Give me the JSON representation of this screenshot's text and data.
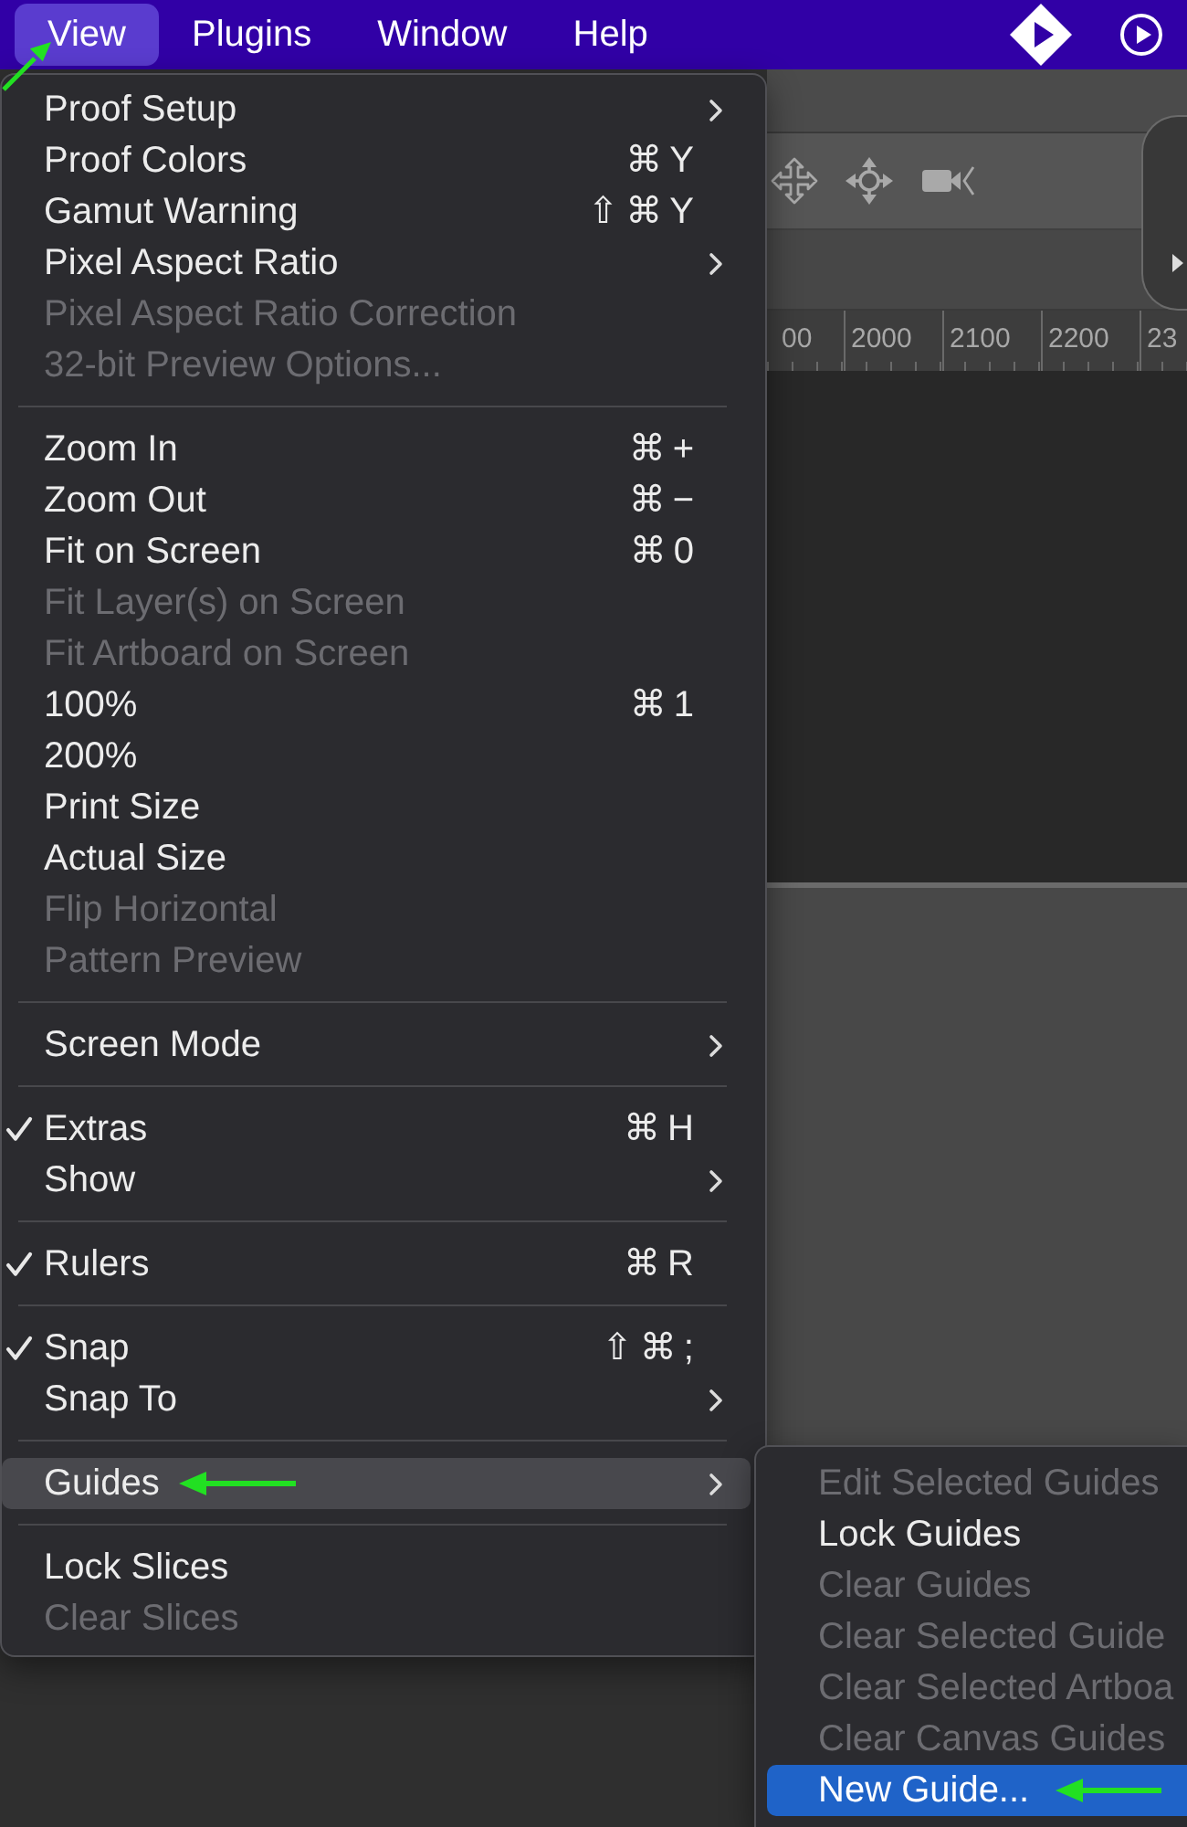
{
  "menu_bar": {
    "items": [
      {
        "label": "View",
        "selected": true,
        "annotation_arrow": true
      },
      {
        "label": "Plugins",
        "selected": false,
        "annotation_arrow": false
      },
      {
        "label": "Window",
        "selected": false,
        "annotation_arrow": false
      },
      {
        "label": "Help",
        "selected": false,
        "annotation_arrow": false
      }
    ]
  },
  "ruler": {
    "labels": [
      "00",
      "2000",
      "2100",
      "2200",
      "23"
    ]
  },
  "view_menu": {
    "items": [
      {
        "kind": "item",
        "label": "Proof Setup",
        "checked": false,
        "disabled": false,
        "has_submenu": true,
        "selected": false,
        "annotation_arrow": false
      },
      {
        "kind": "item",
        "label": "Proof Colors",
        "shortcut": "⌘Y",
        "checked": false,
        "disabled": false,
        "has_submenu": false,
        "selected": false,
        "annotation_arrow": false
      },
      {
        "kind": "item",
        "label": "Gamut Warning",
        "shortcut": "⇧⌘Y",
        "checked": false,
        "disabled": false,
        "has_submenu": false,
        "selected": false,
        "annotation_arrow": false
      },
      {
        "kind": "item",
        "label": "Pixel Aspect Ratio",
        "checked": false,
        "disabled": false,
        "has_submenu": true,
        "selected": false,
        "annotation_arrow": false
      },
      {
        "kind": "item",
        "label": "Pixel Aspect Ratio Correction",
        "checked": false,
        "disabled": true,
        "has_submenu": false,
        "selected": false,
        "annotation_arrow": false
      },
      {
        "kind": "item",
        "label": "32-bit Preview Options...",
        "checked": false,
        "disabled": true,
        "has_submenu": false,
        "selected": false,
        "annotation_arrow": false
      },
      {
        "kind": "separator"
      },
      {
        "kind": "item",
        "label": "Zoom In",
        "shortcut": "⌘+",
        "checked": false,
        "disabled": false,
        "has_submenu": false,
        "selected": false,
        "annotation_arrow": false
      },
      {
        "kind": "item",
        "label": "Zoom Out",
        "shortcut": "⌘−",
        "checked": false,
        "disabled": false,
        "has_submenu": false,
        "selected": false,
        "annotation_arrow": false
      },
      {
        "kind": "item",
        "label": "Fit on Screen",
        "shortcut": "⌘0",
        "checked": false,
        "disabled": false,
        "has_submenu": false,
        "selected": false,
        "annotation_arrow": false
      },
      {
        "kind": "item",
        "label": "Fit Layer(s) on Screen",
        "checked": false,
        "disabled": true,
        "has_submenu": false,
        "selected": false,
        "annotation_arrow": false
      },
      {
        "kind": "item",
        "label": "Fit Artboard on Screen",
        "checked": false,
        "disabled": true,
        "has_submenu": false,
        "selected": false,
        "annotation_arrow": false
      },
      {
        "kind": "item",
        "label": "100%",
        "shortcut": "⌘1",
        "checked": false,
        "disabled": false,
        "has_submenu": false,
        "selected": false,
        "annotation_arrow": false
      },
      {
        "kind": "item",
        "label": "200%",
        "checked": false,
        "disabled": false,
        "has_submenu": false,
        "selected": false,
        "annotation_arrow": false
      },
      {
        "kind": "item",
        "label": "Print Size",
        "checked": false,
        "disabled": false,
        "has_submenu": false,
        "selected": false,
        "annotation_arrow": false
      },
      {
        "kind": "item",
        "label": "Actual Size",
        "checked": false,
        "disabled": false,
        "has_submenu": false,
        "selected": false,
        "annotation_arrow": false
      },
      {
        "kind": "item",
        "label": "Flip Horizontal",
        "checked": false,
        "disabled": true,
        "has_submenu": false,
        "selected": false,
        "annotation_arrow": false
      },
      {
        "kind": "item",
        "label": "Pattern Preview",
        "checked": false,
        "disabled": true,
        "has_submenu": false,
        "selected": false,
        "annotation_arrow": false
      },
      {
        "kind": "separator"
      },
      {
        "kind": "item",
        "label": "Screen Mode",
        "checked": false,
        "disabled": false,
        "has_submenu": true,
        "selected": false,
        "annotation_arrow": false
      },
      {
        "kind": "separator"
      },
      {
        "kind": "item",
        "label": "Extras",
        "shortcut": "⌘H",
        "checked": true,
        "disabled": false,
        "has_submenu": false,
        "selected": false,
        "annotation_arrow": false
      },
      {
        "kind": "item",
        "label": "Show",
        "checked": false,
        "disabled": false,
        "has_submenu": true,
        "selected": false,
        "annotation_arrow": false
      },
      {
        "kind": "separator"
      },
      {
        "kind": "item",
        "label": "Rulers",
        "shortcut": "⌘R",
        "checked": true,
        "disabled": false,
        "has_submenu": false,
        "selected": false,
        "annotation_arrow": false
      },
      {
        "kind": "separator"
      },
      {
        "kind": "item",
        "label": "Snap",
        "shortcut": "⇧⌘;",
        "checked": true,
        "disabled": false,
        "has_submenu": false,
        "selected": false,
        "annotation_arrow": false
      },
      {
        "kind": "item",
        "label": "Snap To",
        "checked": false,
        "disabled": false,
        "has_submenu": true,
        "selected": false,
        "annotation_arrow": false
      },
      {
        "kind": "separator"
      },
      {
        "kind": "item",
        "label": "Guides",
        "checked": false,
        "disabled": false,
        "has_submenu": true,
        "selected": true,
        "annotation_arrow": true
      },
      {
        "kind": "separator"
      },
      {
        "kind": "item",
        "label": "Lock Slices",
        "checked": false,
        "disabled": false,
        "has_submenu": false,
        "selected": false,
        "annotation_arrow": false
      },
      {
        "kind": "item",
        "label": "Clear Slices",
        "checked": false,
        "disabled": true,
        "has_submenu": false,
        "selected": false,
        "annotation_arrow": false
      }
    ]
  },
  "guides_submenu": {
    "items": [
      {
        "label": "Edit Selected Guides",
        "disabled": true,
        "selected": false,
        "annotation_arrow": false
      },
      {
        "label": "Lock Guides",
        "disabled": false,
        "selected": false,
        "annotation_arrow": false
      },
      {
        "label": "Clear Guides",
        "disabled": true,
        "selected": false,
        "annotation_arrow": false
      },
      {
        "label": "Clear Selected Guide",
        "disabled": true,
        "selected": false,
        "annotation_arrow": false
      },
      {
        "label": "Clear Selected Artboa",
        "disabled": true,
        "selected": false,
        "annotation_arrow": false
      },
      {
        "label": "Clear Canvas Guides",
        "disabled": true,
        "selected": false,
        "annotation_arrow": false
      },
      {
        "label": "New Guide...",
        "disabled": false,
        "selected": true,
        "annotation_arrow": true
      }
    ]
  }
}
